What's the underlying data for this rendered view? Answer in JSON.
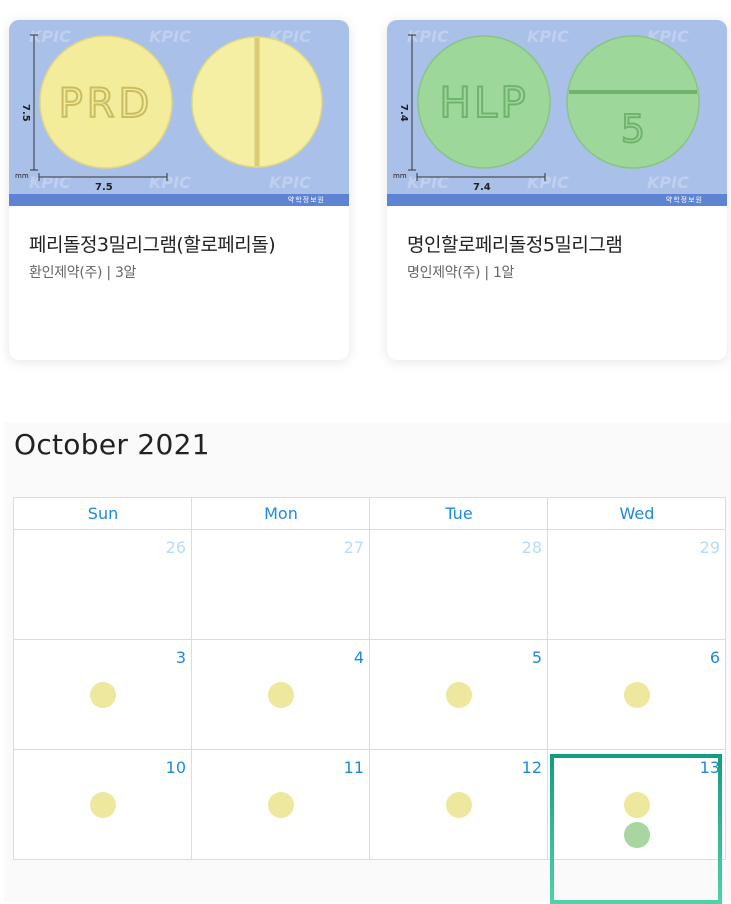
{
  "pills": [
    {
      "name": "페리돌정3밀리그램(할로페리돌)",
      "maker_count": "환인제약(주) | 3알",
      "imprint_front": "PRD",
      "size_h": "7.5",
      "size_w": "7.5",
      "unit": "mm",
      "color": "#f3ec9a",
      "watermark": "KPIC",
      "credit": "약학정보원"
    },
    {
      "name": "명인할로페리돌정5밀리그램",
      "maker_count": "명인제약(주) | 1알",
      "imprint_front": "HLP",
      "imprint_back": "5",
      "size_h": "7.4",
      "size_w": "7.4",
      "unit": "mm",
      "color": "#9ed79a",
      "watermark": "KPIC",
      "credit": "약학정보원"
    }
  ],
  "calendar": {
    "title": "October 2021",
    "weekdays": [
      "Sun",
      "Mon",
      "Tue",
      "Wed"
    ],
    "weeks": [
      [
        {
          "day": "26",
          "other": true,
          "dots": []
        },
        {
          "day": "27",
          "other": true,
          "dots": []
        },
        {
          "day": "28",
          "other": true,
          "dots": []
        },
        {
          "day": "29",
          "other": true,
          "dots": []
        }
      ],
      [
        {
          "day": "3",
          "dots": [
            "yellow"
          ]
        },
        {
          "day": "4",
          "dots": [
            "yellow"
          ]
        },
        {
          "day": "5",
          "dots": [
            "yellow"
          ]
        },
        {
          "day": "6",
          "dots": [
            "yellow"
          ]
        }
      ],
      [
        {
          "day": "10",
          "dots": [
            "yellow"
          ]
        },
        {
          "day": "11",
          "dots": [
            "yellow"
          ]
        },
        {
          "day": "12",
          "dots": [
            "yellow"
          ]
        },
        {
          "day": "13",
          "today": true,
          "dots": [
            "yellow",
            "green"
          ]
        }
      ]
    ],
    "colors": {
      "accent": "#1f8ad8",
      "other_month": "#b8dcf6",
      "yellow_dot": "#eee89e",
      "green_dot": "#a7d6a0",
      "today_border": "#129e7e"
    }
  }
}
